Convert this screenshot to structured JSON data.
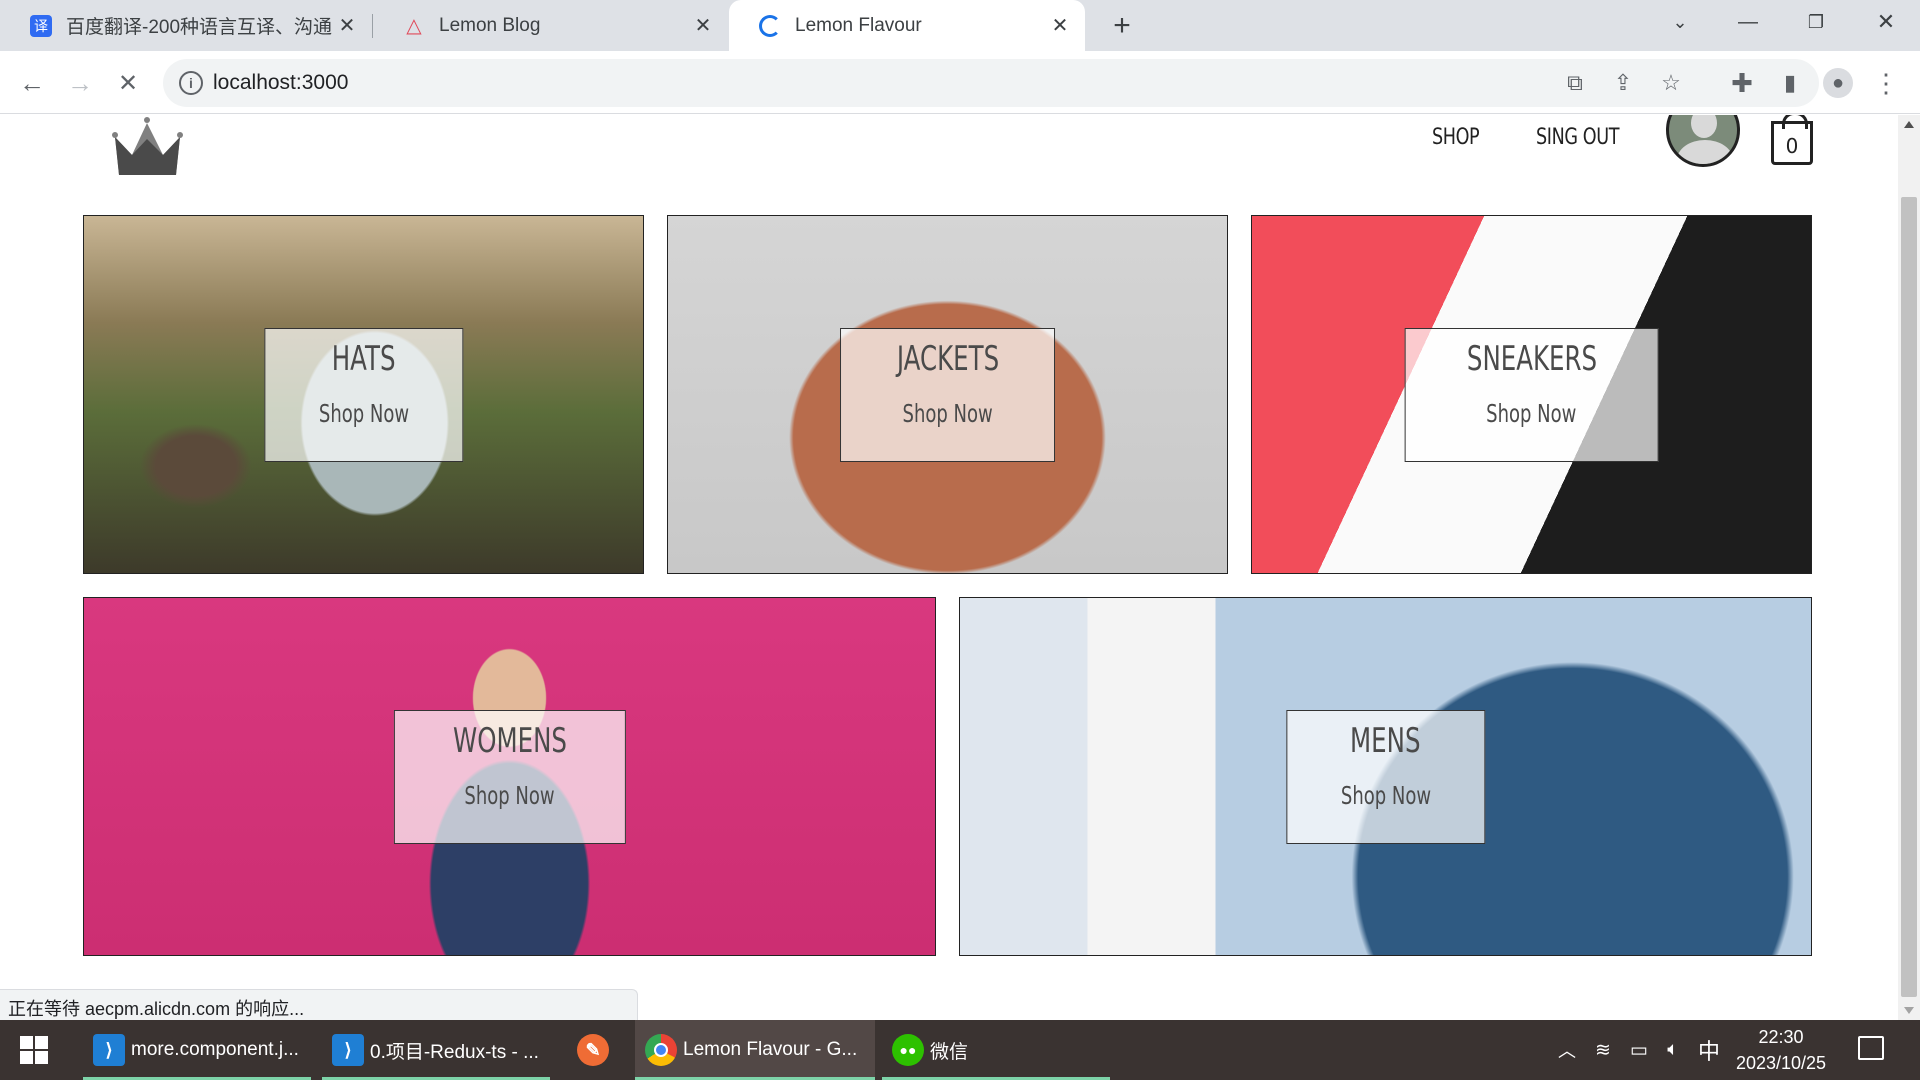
{
  "browser": {
    "tabs": [
      {
        "title": "百度翻译-200种语言互译、沟通",
        "favicon": "translate-icon",
        "active": false
      },
      {
        "title": "Lemon Blog",
        "favicon": "triangle-logo-icon",
        "active": false
      },
      {
        "title": "Lemon Flavour",
        "favicon": "loading-spinner-icon",
        "active": true
      }
    ],
    "url": "localhost:3000",
    "status_text": "正在等待 aecpm.alicdn.com 的响应..."
  },
  "site": {
    "nav": {
      "shop_label": "SHOP",
      "signout_label": "SING OUT",
      "cart_count": "0"
    },
    "categories": [
      {
        "title": "HATS",
        "cta": "Shop Now"
      },
      {
        "title": "JACKETS",
        "cta": "Shop Now"
      },
      {
        "title": "SNEAKERS",
        "cta": "Shop Now"
      },
      {
        "title": "WOMENS",
        "cta": "Shop Now"
      },
      {
        "title": "MENS",
        "cta": "Shop Now"
      }
    ]
  },
  "taskbar": {
    "items": [
      {
        "label": "more.component.j...",
        "icon": "vscode-icon"
      },
      {
        "label": "0.项目-Redux-ts - ...",
        "icon": "vscode-icon"
      },
      {
        "label": "",
        "icon": "postman-icon"
      },
      {
        "label": "Lemon Flavour - G...",
        "icon": "chrome-icon"
      },
      {
        "label": "微信",
        "icon": "wechat-icon"
      }
    ],
    "ime": "中",
    "time": "22:30",
    "date": "2023/10/25"
  },
  "colors": {
    "chrome_tab_bar": "#dee1e6",
    "taskbar": "#3a3331",
    "accent_underline": "#7dd3a8"
  }
}
